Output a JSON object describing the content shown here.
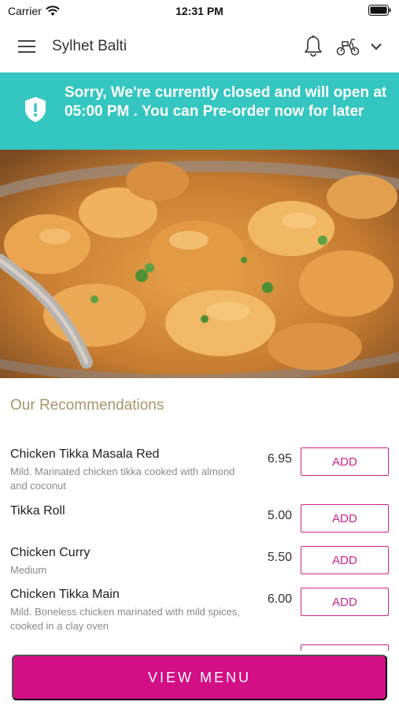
{
  "status_bar": {
    "carrier": "Carrier",
    "time": "12:31 PM"
  },
  "header": {
    "title": "Sylhet Balti",
    "icons": [
      "menu-icon",
      "bell-icon",
      "scooter-icon",
      "chevron-down-icon"
    ]
  },
  "banner": {
    "text": "Sorry, We're currently closed and will open at 05:00 PM . You can Pre-order now for later",
    "icon": "shield-alert-icon",
    "color": "#34c6c1"
  },
  "recommendations": {
    "title": "Our Recommendations",
    "items": [
      {
        "name": "Chicken Tikka Masala Red",
        "description": "Mild. Marinated chicken tikka cooked with almond and coconut",
        "price": "6.95",
        "button": "ADD"
      },
      {
        "name": "Tikka Roll",
        "description": "",
        "price": "5.00",
        "button": "ADD"
      },
      {
        "name": "Chicken Curry",
        "description": "Medium",
        "price": "5.50",
        "button": "ADD"
      },
      {
        "name": "Chicken Tikka Main",
        "description": "Mild. Boneless chicken marinated with mild spices, cooked in a clay oven",
        "price": "6.00",
        "button": "ADD"
      }
    ]
  },
  "footer": {
    "view_menu_label": "VIEW MENU",
    "accent": "#d20f84"
  }
}
